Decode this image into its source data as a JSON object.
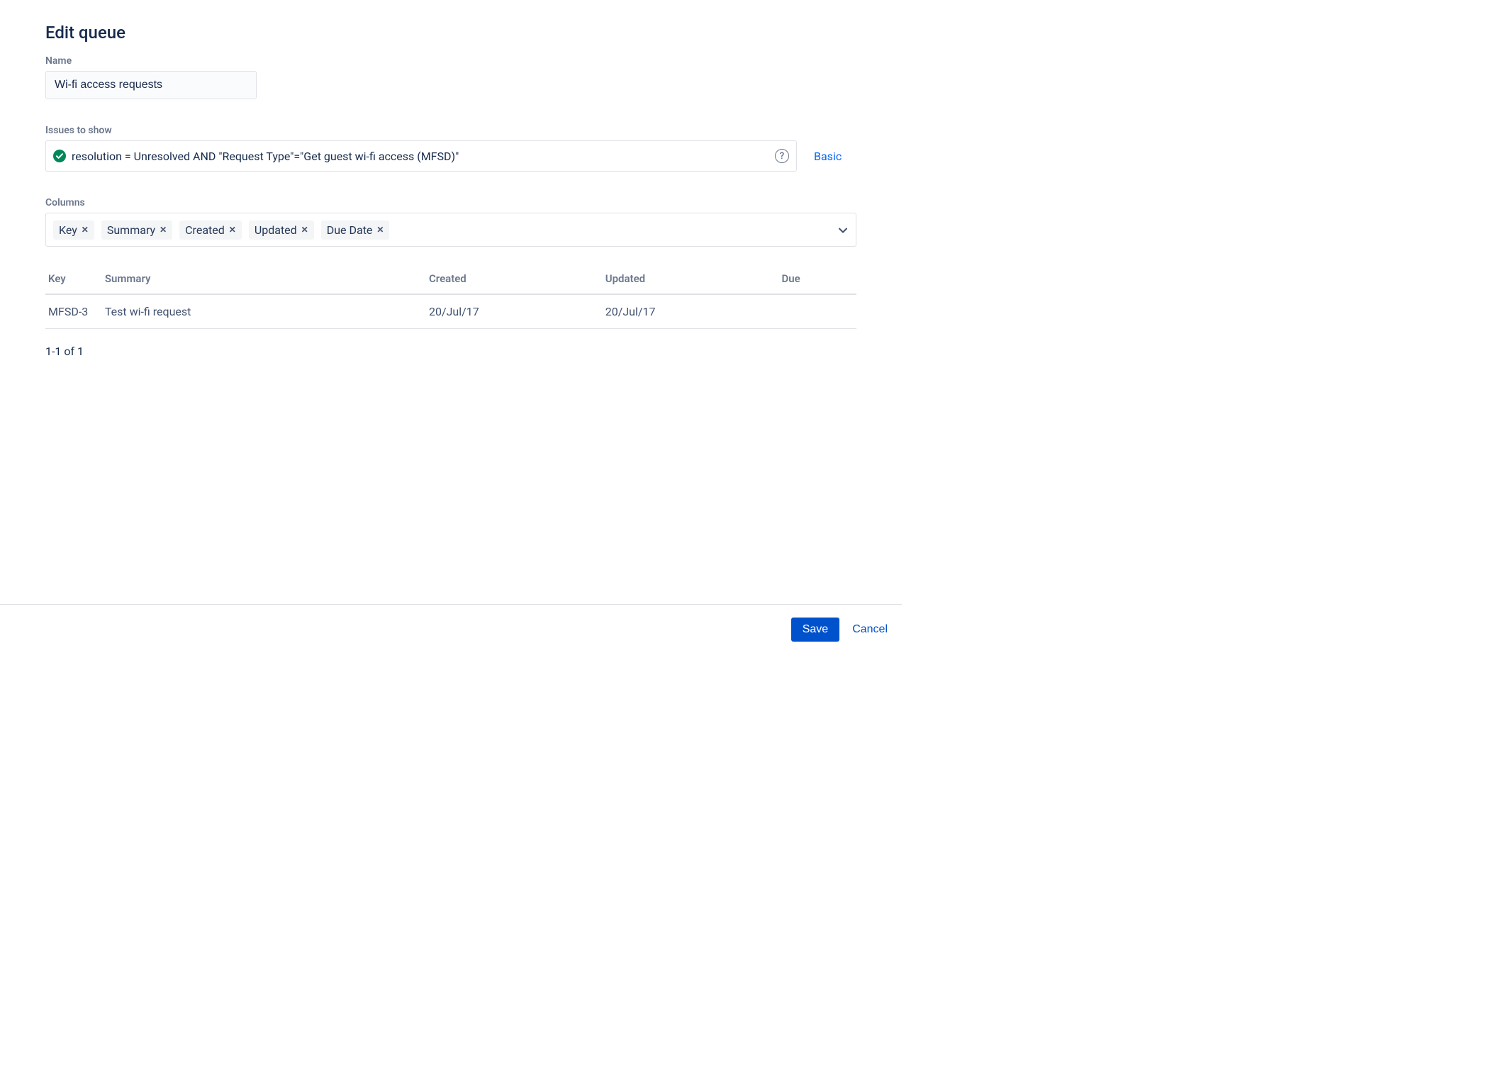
{
  "page": {
    "title": "Edit queue"
  },
  "name": {
    "label": "Name",
    "value": "Wi-fi access requests"
  },
  "issues": {
    "label": "Issues to show",
    "jql": "resolution = Unresolved AND \"Request Type\"=\"Get guest wi-fi access (MFSD)\"",
    "status": "valid",
    "basic_link": "Basic"
  },
  "columns": {
    "label": "Columns",
    "tags": [
      "Key",
      "Summary",
      "Created",
      "Updated",
      "Due Date"
    ]
  },
  "table": {
    "headers": {
      "key": "Key",
      "summary": "Summary",
      "created": "Created",
      "updated": "Updated",
      "due": "Due"
    },
    "rows": [
      {
        "key": "MFSD-3",
        "summary": "Test wi-fi request",
        "created": "20/Jul/17",
        "updated": "20/Jul/17",
        "due": ""
      }
    ]
  },
  "pagination": "1-1 of 1",
  "footer": {
    "save": "Save",
    "cancel": "Cancel"
  }
}
